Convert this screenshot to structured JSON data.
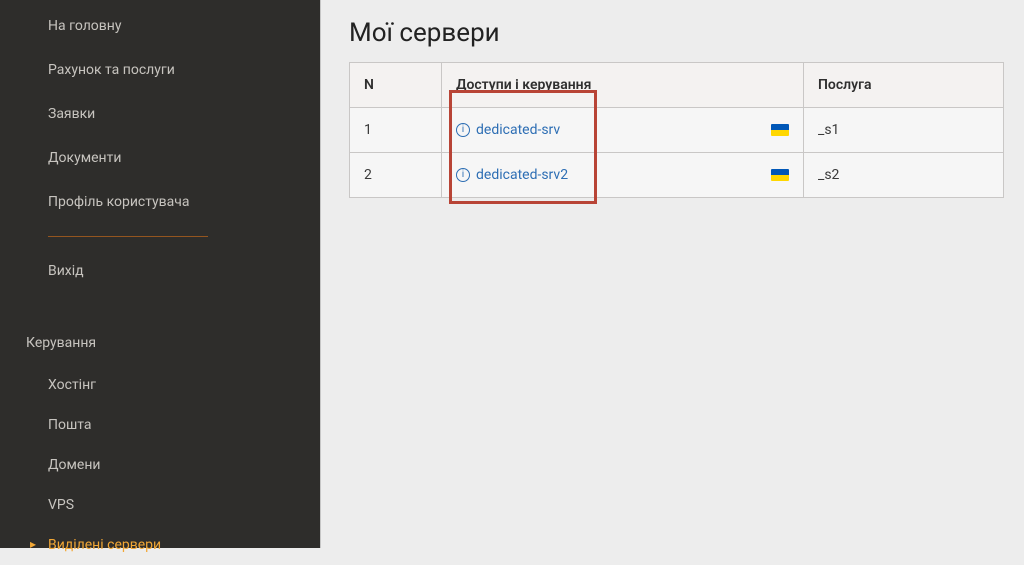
{
  "sidebar": {
    "nav": [
      {
        "label": "На головну"
      },
      {
        "label": "Рахунок та послуги"
      },
      {
        "label": "Заявки"
      },
      {
        "label": "Документи"
      },
      {
        "label": "Профіль користувача"
      }
    ],
    "logout_label": "Вихід",
    "section_title": "Керування",
    "manage": [
      {
        "label": "Хостінг"
      },
      {
        "label": "Пошта"
      },
      {
        "label": "Домени"
      },
      {
        "label": "VPS"
      },
      {
        "label": "Виділені сервери",
        "active": true
      }
    ]
  },
  "page": {
    "title": "Мої сервери",
    "table": {
      "headers": {
        "n": "N",
        "access": "Доступи і керування",
        "service": "Послуга"
      },
      "rows": [
        {
          "n": "1",
          "name": "dedicated-srv",
          "flag": "ua",
          "service": "_s1"
        },
        {
          "n": "2",
          "name": "dedicated-srv2",
          "flag": "ua",
          "service": "_s2"
        }
      ]
    }
  }
}
